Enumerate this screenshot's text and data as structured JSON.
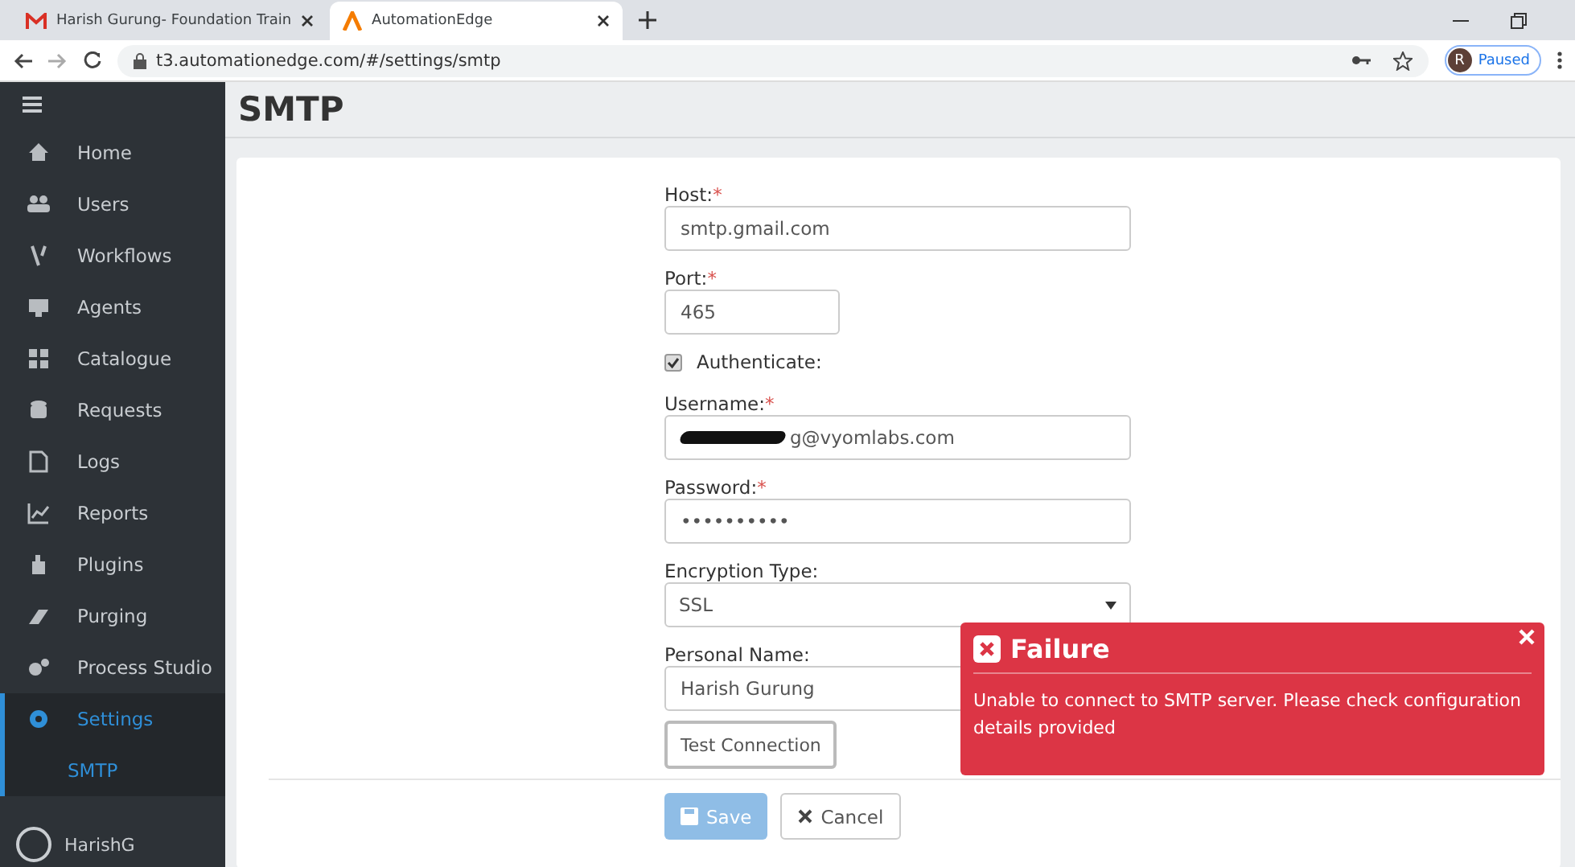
{
  "browser": {
    "tabs": [
      {
        "title": "Harish Gurung- Foundation Train",
        "selected": false
      },
      {
        "title": "AutomationEdge",
        "selected": true
      }
    ],
    "url": "t3.automationedge.com/#/settings/smtp",
    "profile": {
      "initial": "R",
      "label": "Paused"
    }
  },
  "sidebar": {
    "items": [
      {
        "label": "Home",
        "selected": false
      },
      {
        "label": "Users",
        "selected": false
      },
      {
        "label": "Workflows",
        "selected": false
      },
      {
        "label": "Agents",
        "selected": false
      },
      {
        "label": "Catalogue",
        "selected": false
      },
      {
        "label": "Requests",
        "selected": false
      },
      {
        "label": "Logs",
        "selected": false
      },
      {
        "label": "Reports",
        "selected": false
      },
      {
        "label": "Plugins",
        "selected": false
      },
      {
        "label": "Purging",
        "selected": false
      },
      {
        "label": "Process Studio",
        "selected": false
      },
      {
        "label": "Settings",
        "selected": true,
        "expanded": true,
        "children": [
          {
            "label": "SMTP",
            "selected": true
          }
        ]
      }
    ],
    "user": "HarishG"
  },
  "page": {
    "title": "SMTP"
  },
  "form": {
    "fields": [
      {
        "kind": "text",
        "label": "Host:",
        "required_mark": "*",
        "value": "smtp.gmail.com"
      },
      {
        "kind": "short",
        "label": "Port:",
        "required_mark": "*",
        "value": "465"
      },
      {
        "kind": "checkbox",
        "label": "Authenticate:",
        "checked": true
      },
      {
        "kind": "redacted",
        "label": "Username:",
        "required_mark": "*",
        "value": "g@vyomlabs.com"
      },
      {
        "kind": "text",
        "label": "Password:",
        "required_mark": "*",
        "value": "••••••••••"
      },
      {
        "kind": "select",
        "label": "Encryption Type:",
        "value": "SSL"
      },
      {
        "kind": "text",
        "label": "Personal Name:",
        "value": "Harish Gurung"
      }
    ],
    "test_button": "Test Connection",
    "save_button": {
      "label": "Save",
      "disabled": true
    },
    "cancel_button": "Cancel"
  },
  "toast": {
    "title": "Failure",
    "message": "Unable to connect to SMTP server. Please check configuration details provided"
  }
}
